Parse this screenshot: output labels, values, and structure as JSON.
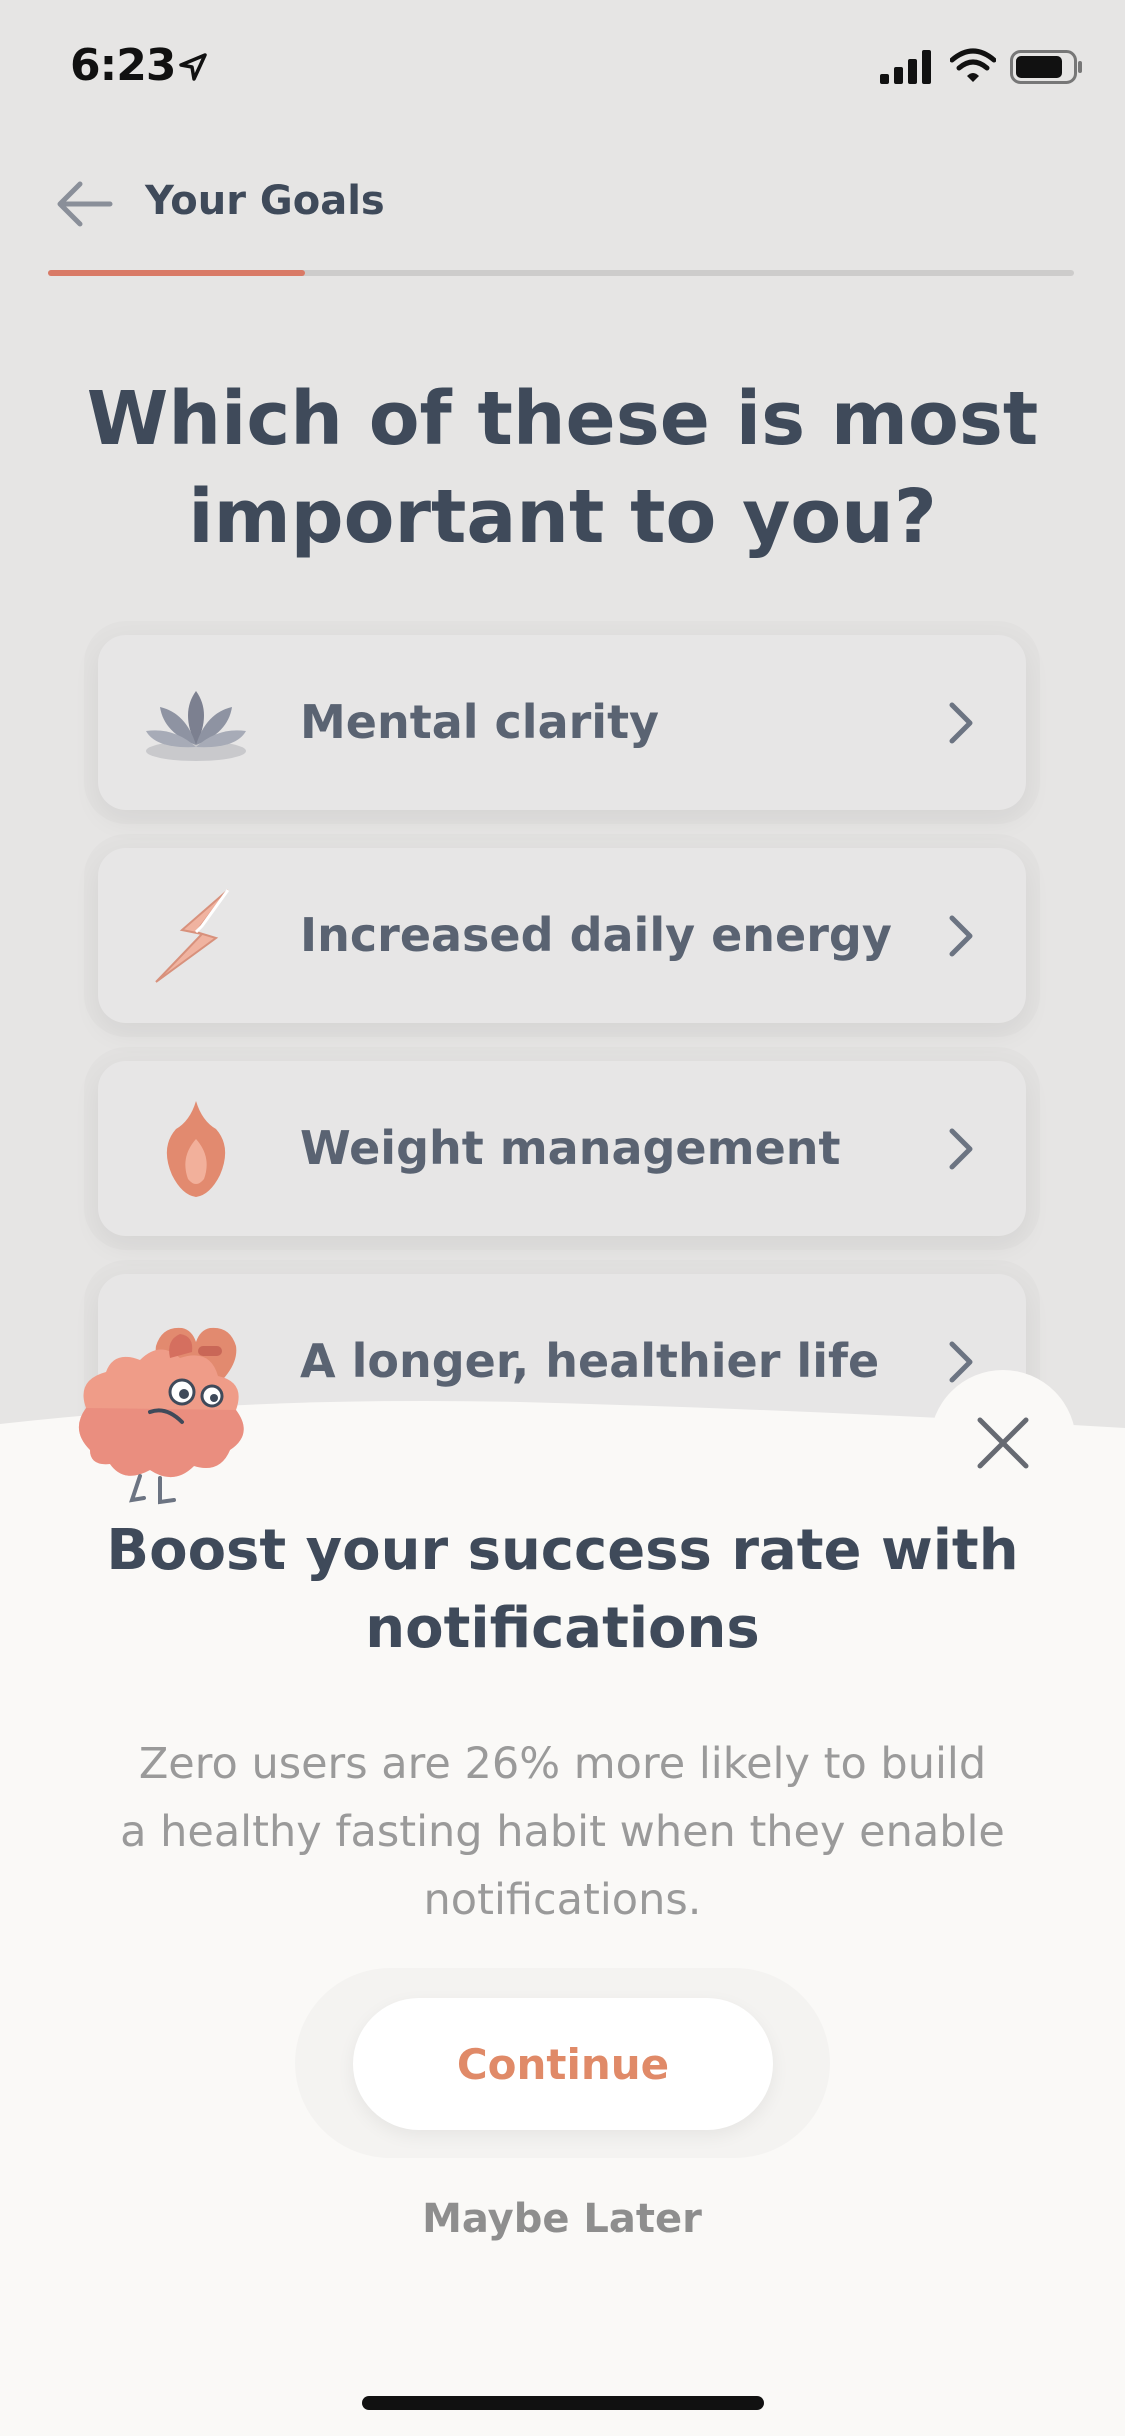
{
  "status_bar": {
    "time": "6:23",
    "icons": [
      "location-arrow-icon",
      "signal-icon",
      "wifi-icon",
      "battery-icon"
    ]
  },
  "nav": {
    "title": "Your Goals",
    "back_icon": "arrow-left-icon"
  },
  "progress": {
    "value": 0.25,
    "fill_color": "#d97a66",
    "track_color": "#cdcccb"
  },
  "question": "Which of these is most important to you?",
  "options": [
    {
      "label": "Mental clarity",
      "icon": "lotus-icon"
    },
    {
      "label": "Increased daily energy",
      "icon": "lightning-icon"
    },
    {
      "label": "Weight management",
      "icon": "flame-icon"
    },
    {
      "label": "A longer, healthier life",
      "icon": "heart-icon"
    }
  ],
  "sheet": {
    "title": "Boost your success rate with notifications",
    "body": "Zero users are 26% more likely to build a healthy fasting habit when they enable notifications.",
    "continue_label": "Continue",
    "maybe_later_label": "Maybe Later",
    "close_icon": "close-icon",
    "mascot": "brain-mascot-icon"
  },
  "colors": {
    "accent": "#e08a68",
    "text_primary": "#3f4a5a",
    "background": "#e6e5e4",
    "sheet": "#faf9f7"
  }
}
